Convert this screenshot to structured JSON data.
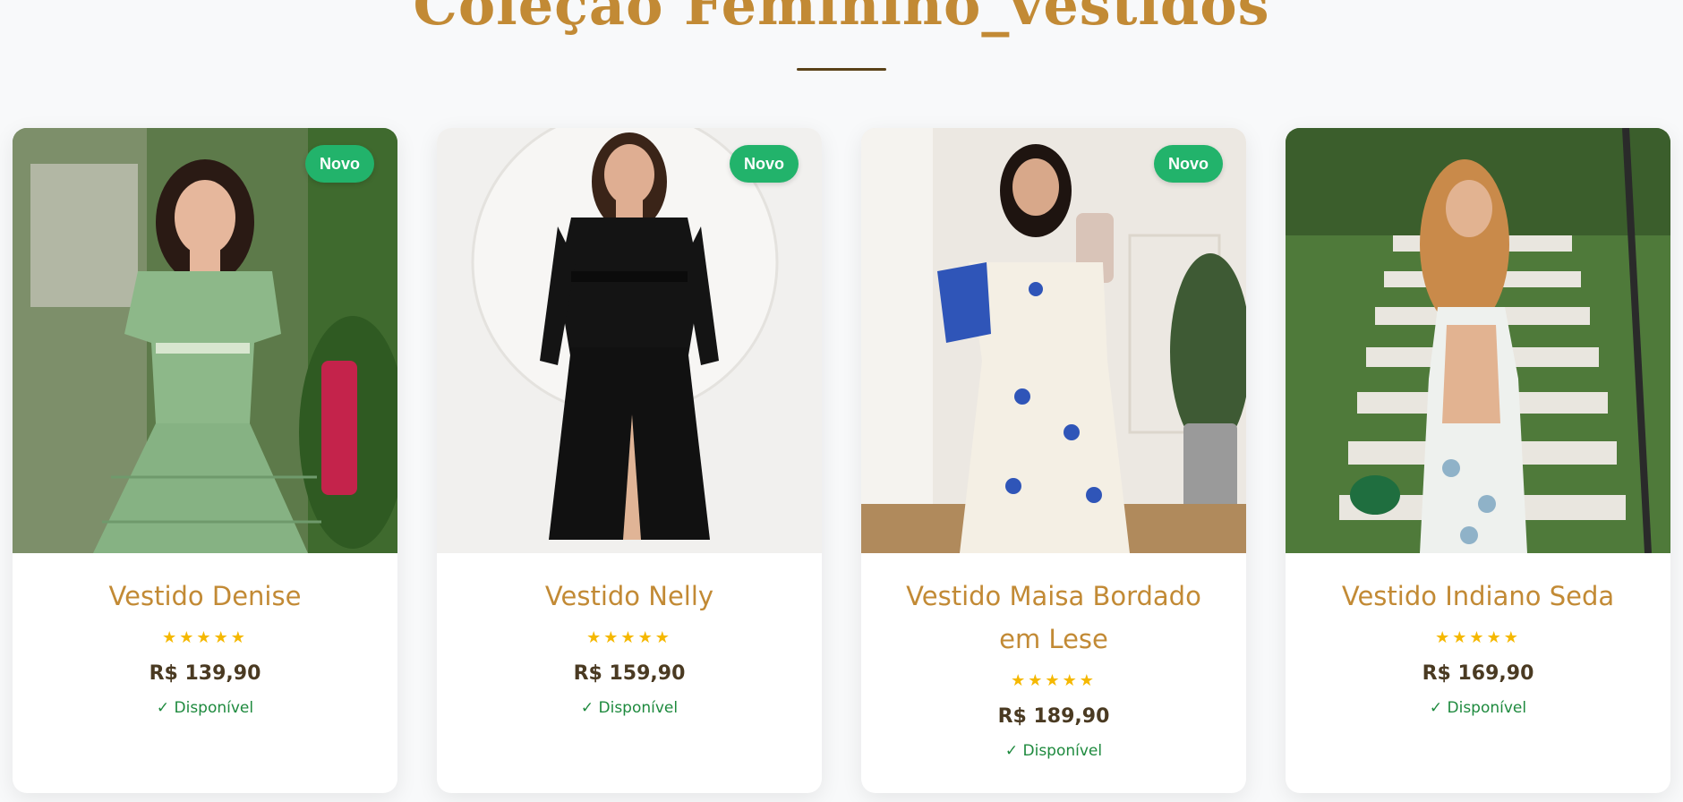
{
  "section": {
    "title": "Coleção Feminino_vestidos"
  },
  "icons": {
    "rating": "star-icon",
    "stock": "check-icon"
  },
  "colors": {
    "accent": "#c28a35",
    "badge": "#22b36b",
    "price": "#4a3a22",
    "stock": "#1e8a3e",
    "stars": "#f5b800"
  },
  "products": [
    {
      "name": "Vestido Denise",
      "badge": "Novo",
      "rating": "★★★★★",
      "price": "R$ 139,90",
      "stock": "✓ Disponível"
    },
    {
      "name": "Vestido Nelly",
      "badge": "Novo",
      "rating": "★★★★★",
      "price": "R$ 159,90",
      "stock": "✓ Disponível"
    },
    {
      "name": "Vestido Maisa Bordado em Lese",
      "badge": "Novo",
      "rating": "★★★★★",
      "price": "R$ 189,90",
      "stock": "✓ Disponível"
    },
    {
      "name": "Vestido Indiano Seda",
      "badge": "",
      "rating": "★★★★★",
      "price": "R$ 169,90",
      "stock": "✓ Disponível"
    }
  ]
}
